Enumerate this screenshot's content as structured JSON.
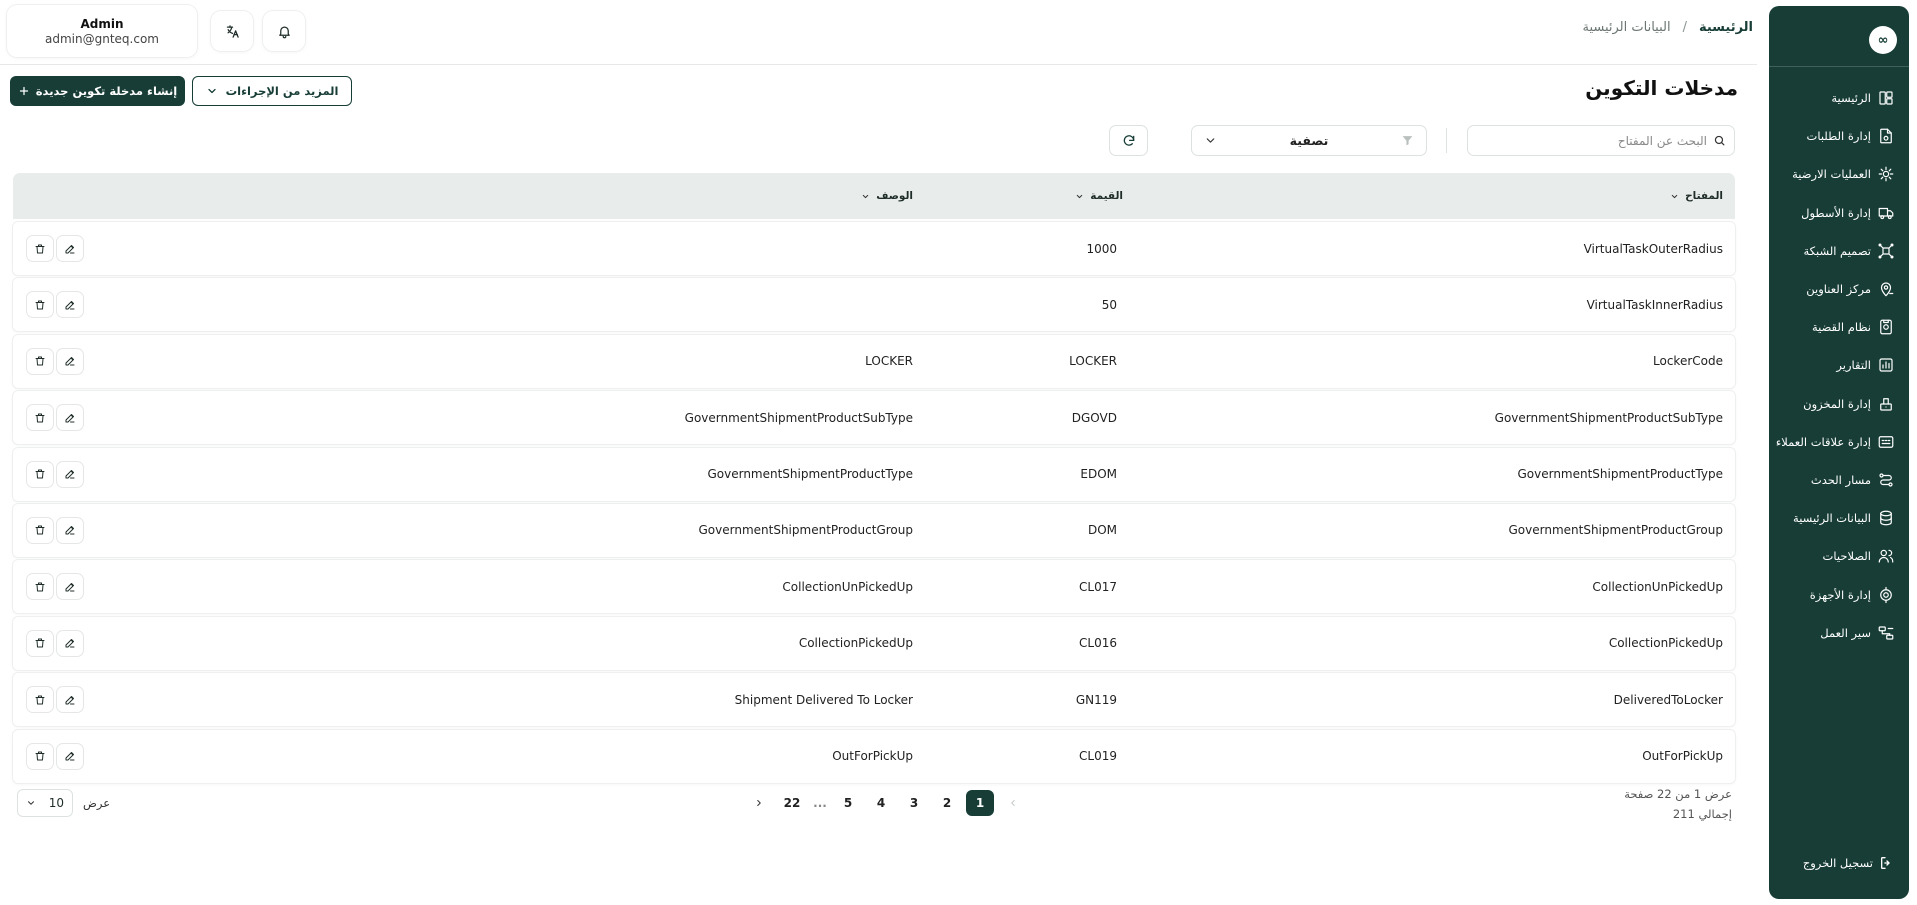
{
  "sidebar": {
    "logo": "∞",
    "items": [
      {
        "label": "الرئيسية",
        "icon": "dashboard-icon"
      },
      {
        "label": "إدارة الطلبات",
        "icon": "orders-icon"
      },
      {
        "label": "العمليات الارضية",
        "icon": "ground-ops-icon"
      },
      {
        "label": "إدارة الأسطول",
        "icon": "truck-icon"
      },
      {
        "label": "تصميم الشبكة",
        "icon": "network-icon"
      },
      {
        "label": "مركز العناوين",
        "icon": "location-icon"
      },
      {
        "label": "نظام القضية",
        "icon": "case-icon"
      },
      {
        "label": "التقارير",
        "icon": "reports-icon"
      },
      {
        "label": "إدارة المخزون",
        "icon": "inventory-icon"
      },
      {
        "label": "إدارة علاقات العملاء",
        "icon": "crm-icon"
      },
      {
        "label": "مسار الحدث",
        "icon": "route-icon"
      },
      {
        "label": "البيانات الرئيسية",
        "icon": "database-icon"
      },
      {
        "label": "الصلاحيات",
        "icon": "users-icon"
      },
      {
        "label": "إدارة الأجهزة",
        "icon": "devices-icon"
      },
      {
        "label": "سير العمل",
        "icon": "workflow-icon"
      }
    ],
    "logout": "تسجيل الخروج"
  },
  "breadcrumb": {
    "home": "الرئيسية",
    "separator": "/",
    "current": "البيانات الرئيسية"
  },
  "user": {
    "name": "Admin",
    "email": "admin@gnteq.com"
  },
  "page": {
    "title": "مدخلات التكوين",
    "create_label": "إنشاء مدخلة تكوين جديدة",
    "more_actions_label": "المزيد من الإجراءات"
  },
  "toolbar": {
    "search_placeholder": "البحث عن المفتاح",
    "filter_label": "تصفية"
  },
  "table": {
    "columns": {
      "key": "المفتاح",
      "value": "القيمة",
      "description": "الوصف"
    },
    "rows": [
      {
        "key": "VirtualTaskOuterRadius",
        "value": "1000",
        "description": ""
      },
      {
        "key": "VirtualTaskInnerRadius",
        "value": "50",
        "description": ""
      },
      {
        "key": "LockerCode",
        "value": "LOCKER",
        "description": "LOCKER"
      },
      {
        "key": "GovernmentShipmentProductSubType",
        "value": "DGOVD",
        "description": "GovernmentShipmentProductSubType"
      },
      {
        "key": "GovernmentShipmentProductType",
        "value": "EDOM",
        "description": "GovernmentShipmentProductType"
      },
      {
        "key": "GovernmentShipmentProductGroup",
        "value": "DOM",
        "description": "GovernmentShipmentProductGroup"
      },
      {
        "key": "CollectionUnPickedUp",
        "value": "CL017",
        "description": "CollectionUnPickedUp"
      },
      {
        "key": "CollectionPickedUp",
        "value": "CL016",
        "description": "CollectionPickedUp"
      },
      {
        "key": "DeliveredToLocker",
        "value": "GN119",
        "description": "Shipment Delivered To Locker"
      },
      {
        "key": "OutForPickUp",
        "value": "CL019",
        "description": "OutForPickUp"
      }
    ]
  },
  "pagination": {
    "info_line1": "عرض 1 من 22 صفحة",
    "info_line2": "إجمالي 211",
    "pages": [
      "1",
      "2",
      "3",
      "4",
      "5",
      "...",
      "22"
    ],
    "current": "1",
    "per_page_label": "عرض",
    "per_page_value": "10"
  },
  "colors": {
    "brand": "#173d36",
    "header_bg": "#e8ecea"
  }
}
